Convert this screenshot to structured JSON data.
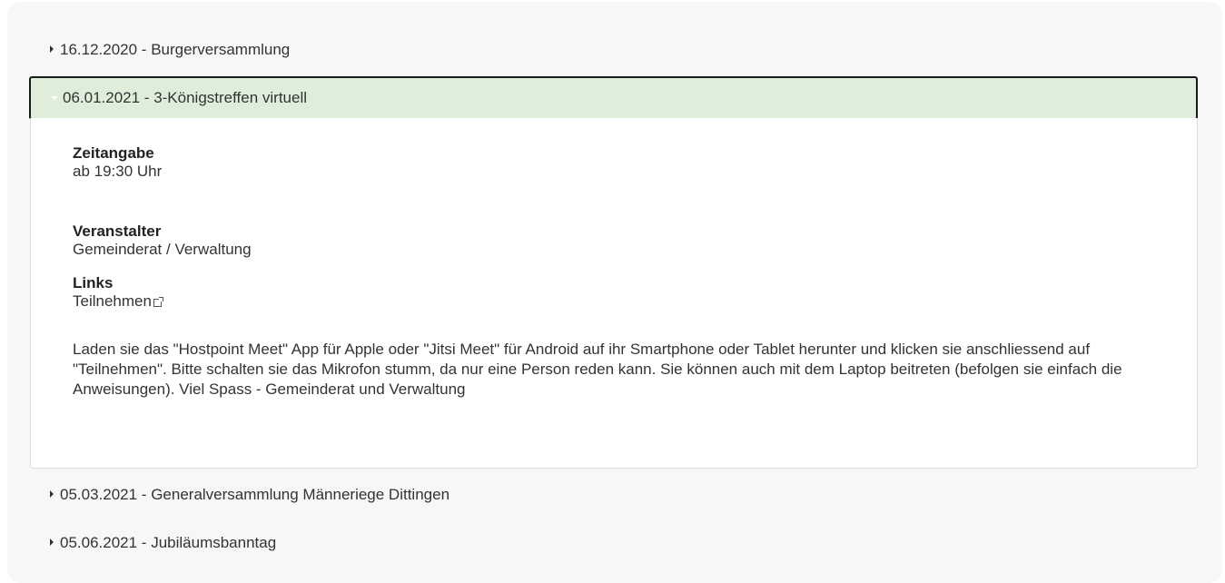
{
  "events": {
    "before": [
      {
        "label": "16.12.2020 - Burgerversammlung"
      }
    ],
    "active": {
      "label": "06.01.2021 - 3-Königstreffen virtuell",
      "zeit_title": "Zeitangabe",
      "zeit_value": "ab 19:30 Uhr",
      "veranstalter_title": "Veranstalter",
      "veranstalter_value": "Gemeinderat / Verwaltung",
      "links_title": "Links",
      "links_value": "Teilnehmen",
      "description": "Laden sie das \"Hostpoint Meet\" App für Apple oder \"Jitsi Meet\" für Android auf ihr Smartphone oder Tablet herunter und klicken sie anschliessend auf \"Teilnehmen\". Bitte schalten sie das Mikrofon stumm, da nur eine Person reden kann. Sie können auch mit dem Laptop beitreten (befolgen sie einfach die Anweisungen). Viel Spass - Gemeinderat und Verwaltung"
    },
    "after": [
      {
        "label": "05.03.2021 - Generalversammlung Männeriege Dittingen"
      },
      {
        "label": "05.06.2021 - Jubiläumsbanntag"
      }
    ]
  },
  "colors": {
    "active_header_bg": "#dfeeda",
    "panel_bg": "#f7f7f7"
  }
}
